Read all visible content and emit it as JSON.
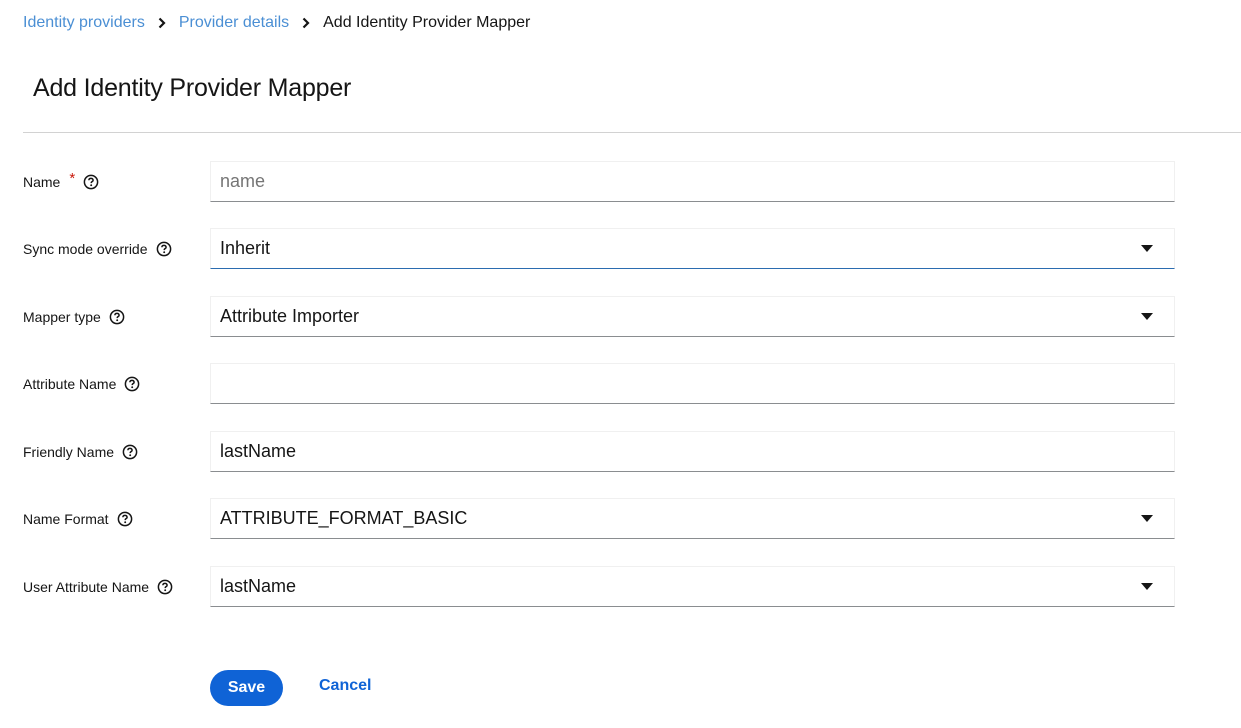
{
  "breadcrumb": {
    "items": [
      {
        "label": "Identity providers"
      },
      {
        "label": "Provider details"
      },
      {
        "label": "Add Identity Provider Mapper"
      }
    ]
  },
  "page": {
    "title": "Add Identity Provider Mapper"
  },
  "form": {
    "name": {
      "label": "Name",
      "required_mark": "*",
      "value": ""
    },
    "sync_mode": {
      "label": "Sync mode override",
      "value": "Inherit"
    },
    "mapper_type": {
      "label": "Mapper type",
      "value": "Attribute Importer"
    },
    "attribute_name": {
      "label": "Attribute Name",
      "value": ""
    },
    "friendly_name": {
      "label": "Friendly Name",
      "value": "lastName"
    },
    "name_format": {
      "label": "Name Format",
      "value": "ATTRIBUTE_FORMAT_BASIC"
    },
    "user_attribute_name": {
      "label": "User Attribute Name",
      "value": "lastName"
    }
  },
  "actions": {
    "save_label": "Save",
    "cancel_label": "Cancel"
  },
  "colors": {
    "link": "#4b8fd4",
    "primary": "#0f63d6",
    "required": "#c9190b"
  },
  "icons": {
    "help": "help-circle-icon",
    "separator": "chevron-right-icon",
    "caret": "caret-down-icon"
  }
}
